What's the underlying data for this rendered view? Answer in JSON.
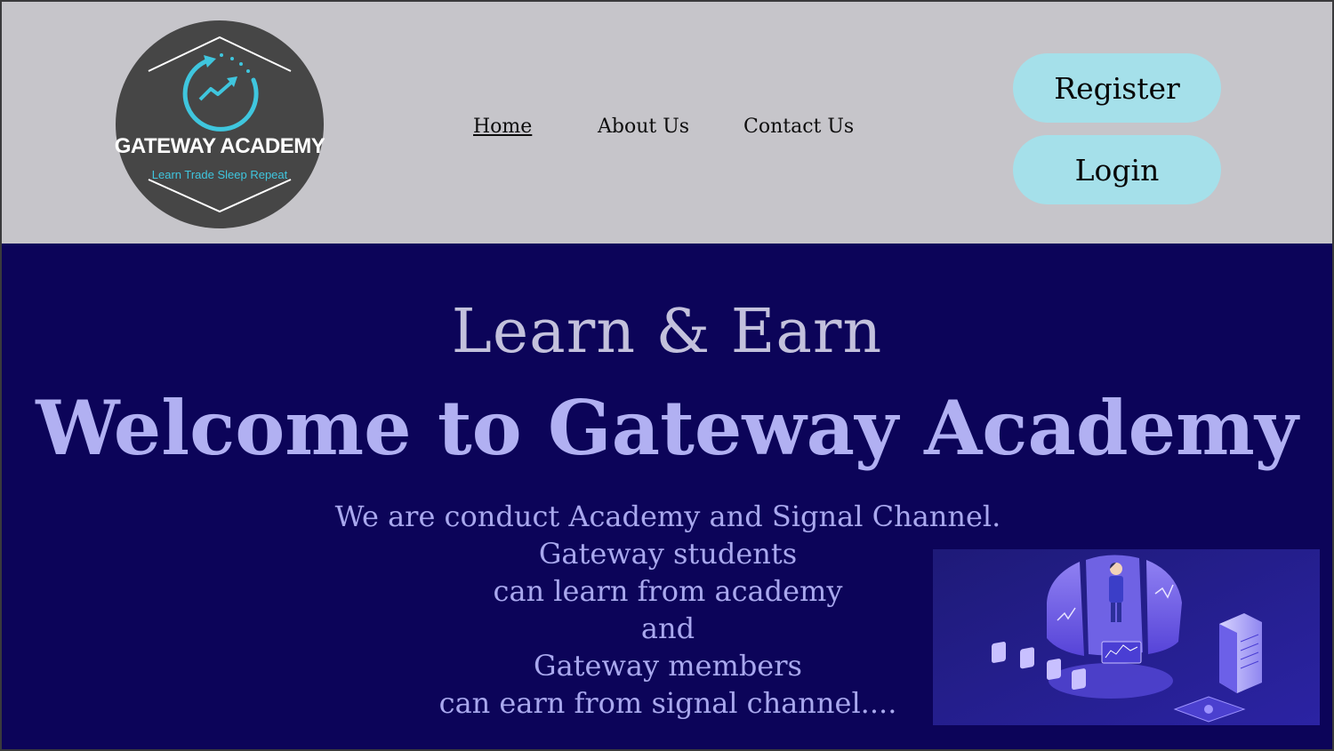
{
  "header": {
    "logo": {
      "title": "GATEWAY ACADEMY",
      "tagline": "Learn Trade Sleep Repeat"
    },
    "nav": [
      {
        "label": "Home"
      },
      {
        "label": "About Us"
      },
      {
        "label": "Contact Us"
      }
    ],
    "register_label": "Register",
    "login_label": "Login"
  },
  "hero": {
    "subtitle": "Learn & Earn",
    "title": "Welcome to Gateway Academy",
    "description_lines": [
      "We are conduct Academy and Signal Channel.",
      "Gateway students",
      "can learn from academy",
      "and",
      "Gateway members",
      "can earn from signal channel...."
    ]
  },
  "colors": {
    "header_bg": "#c6c5ca",
    "hero_bg": "#0c0459",
    "button_bg": "#a5e0ea",
    "title_color": "#b1b0f2",
    "logo_accent": "#3fc6de"
  },
  "icons": {
    "logo_icon": "trend-up-circular-arrow-icon",
    "illustration": "trader-dashboard-illustration"
  }
}
